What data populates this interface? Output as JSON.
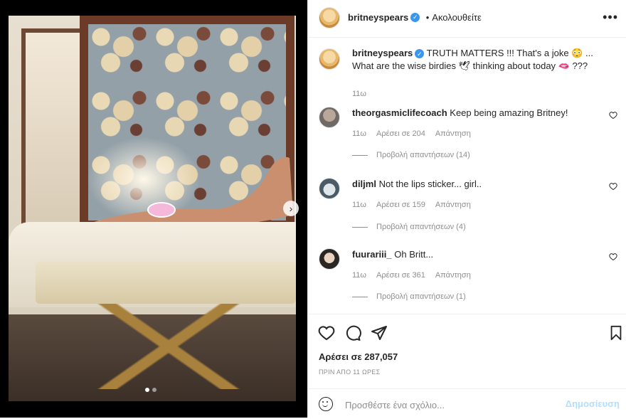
{
  "post": {
    "username": "britneyspears",
    "follow_sep": "•",
    "follow_label": "Ακολουθείτε",
    "more_icon": "more-horizontal-icon",
    "caption": "TRUTH MATTERS !!! That's a joke 😳 ... What are the wise birdies 🕊 thinking about today 🫦 ???",
    "caption_time": "11ω"
  },
  "media": {
    "carousel_dots": 2,
    "active_dot": 0,
    "next_icon": "chevron-right-icon"
  },
  "comments": [
    {
      "username": "theorgasmiclifecoach",
      "text": "Keep being amazing Britney!",
      "time": "11ω",
      "likes": "Αρέσει σε 204",
      "reply": "Απάντηση",
      "view_replies": "Προβολή απαντήσεων (14)"
    },
    {
      "username": "diljml",
      "text": "Not the lips sticker... girl..",
      "time": "11ω",
      "likes": "Αρέσει σε 159",
      "reply": "Απάντηση",
      "view_replies": "Προβολή απαντήσεων (4)"
    },
    {
      "username": "fuurariii_",
      "text": "Oh Britt...",
      "time": "11ω",
      "likes": "Αρέσει σε 361",
      "reply": "Απάντηση",
      "view_replies": "Προβολή απαντήσεων (1)"
    }
  ],
  "actions": {
    "like_icon": "heart-icon",
    "comment_icon": "comment-icon",
    "share_icon": "send-icon",
    "save_icon": "bookmark-icon",
    "likes_label": "Αρέσει σε 287,057",
    "posted_ago": "ΠΡΙΝ ΑΠΟ 11 ΩΡΕΣ"
  },
  "composer": {
    "placeholder": "Προσθέστε ένα σχόλιο...",
    "post_label": "Δημοσίευση",
    "emoji_icon": "emoji-icon"
  },
  "colors": {
    "verified": "#3897f0",
    "muted": "#8e8e8e",
    "post_disabled": "#b2dffc"
  }
}
